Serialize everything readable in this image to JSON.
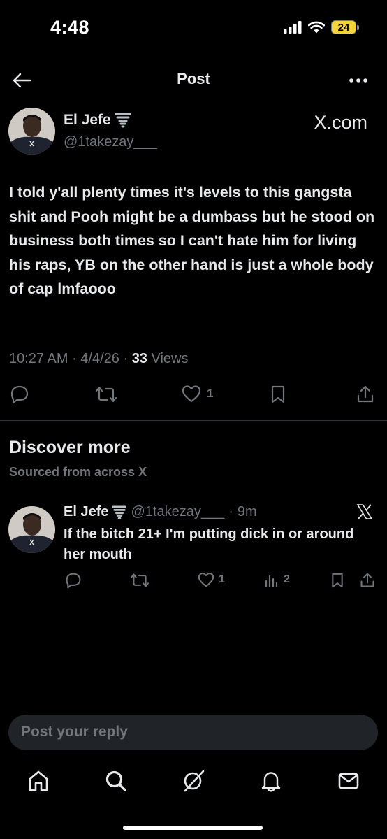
{
  "status_bar": {
    "time": "4:48",
    "battery": "24",
    "icons": [
      "signal-icon",
      "wifi-icon",
      "battery-icon"
    ]
  },
  "header": {
    "title": "Post",
    "back_icon": "arrow-left-icon",
    "more_icon": "more-horizontal-icon"
  },
  "main_post": {
    "author_name": "El Jefe",
    "author_badge_icon": "tornado-emoji-icon",
    "handle": "@1takezay___",
    "source_label": "X.com",
    "text": "I told y'all plenty times it's levels to this gangsta shit and Pooh might be a dumbass but he stood on business both times so I can't hate him for living his raps, YB on the other hand is just a whole body of cap lmfaooo",
    "time": "10:27 AM",
    "date": "4/4/26",
    "views_count": "33",
    "views_label": "Views",
    "likes": "1"
  },
  "discover": {
    "title": "Discover more",
    "subtitle": "Sourced from across X"
  },
  "related_post": {
    "author_name": "El Jefe",
    "handle": "@1takezay___",
    "age": "9m",
    "text": "If the bitch 21+ I'm putting dick in or around her mouth",
    "likes": "1",
    "views": "2"
  },
  "reply": {
    "placeholder": "Post your reply"
  },
  "nav": {
    "items": [
      "home-icon",
      "search-icon",
      "grok-icon",
      "notifications-icon",
      "messages-icon"
    ]
  },
  "colors": {
    "background": "#000000",
    "text": "#e7e9ea",
    "muted": "#71767b",
    "divider": "#2f3336",
    "reply_bg": "#202327",
    "battery": "#f4d43a"
  }
}
